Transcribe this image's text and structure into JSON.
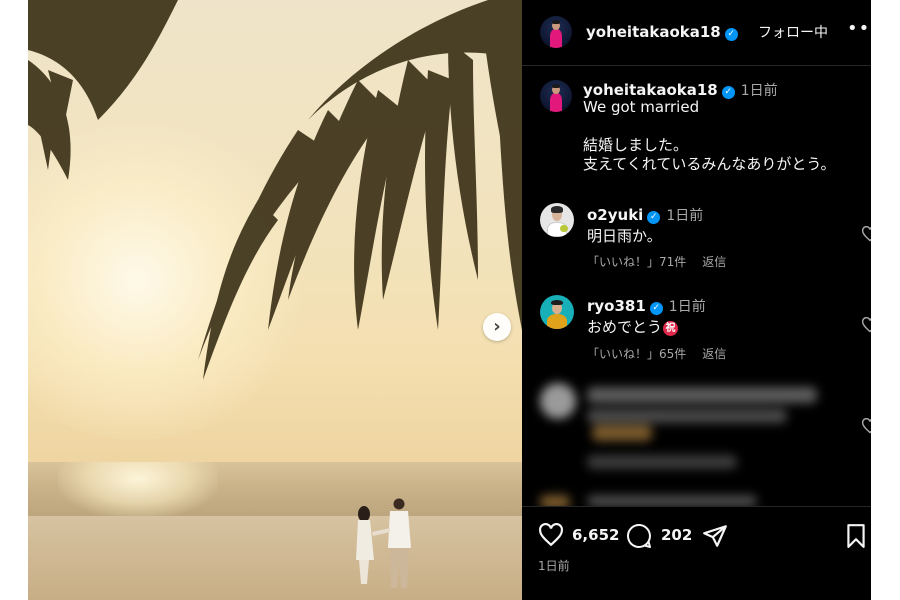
{
  "post": {
    "username": "yoheitakaoka18",
    "follow_label": "フォロー中",
    "more_label": "•••",
    "caption_time": "1日前",
    "caption_lines": [
      "We got married",
      "結婚しました。",
      "支えてくれているみんなありがとう。"
    ]
  },
  "comments": [
    {
      "username": "o2yuki",
      "time": "1日前",
      "text": "明日雨か。",
      "likes": "「いいね！」71件",
      "reply": "返信"
    },
    {
      "username": "ryo381",
      "time": "1日前",
      "text": "おめでとう",
      "emoji": "祝",
      "likes": "「いいね！」65件",
      "reply": "返信"
    }
  ],
  "actions": {
    "like_count": "6,652",
    "comment_count": "202",
    "post_time": "1日前"
  },
  "icons": {
    "verified": "verified-badge-icon",
    "next": "chevron-right-icon",
    "like": "heart-icon",
    "comment": "comment-bubble-icon",
    "share": "paper-plane-icon",
    "save": "bookmark-icon"
  },
  "colors": {
    "verified": "#0095f6",
    "iwai": "#e0294a",
    "panel_bg": "#000000"
  }
}
